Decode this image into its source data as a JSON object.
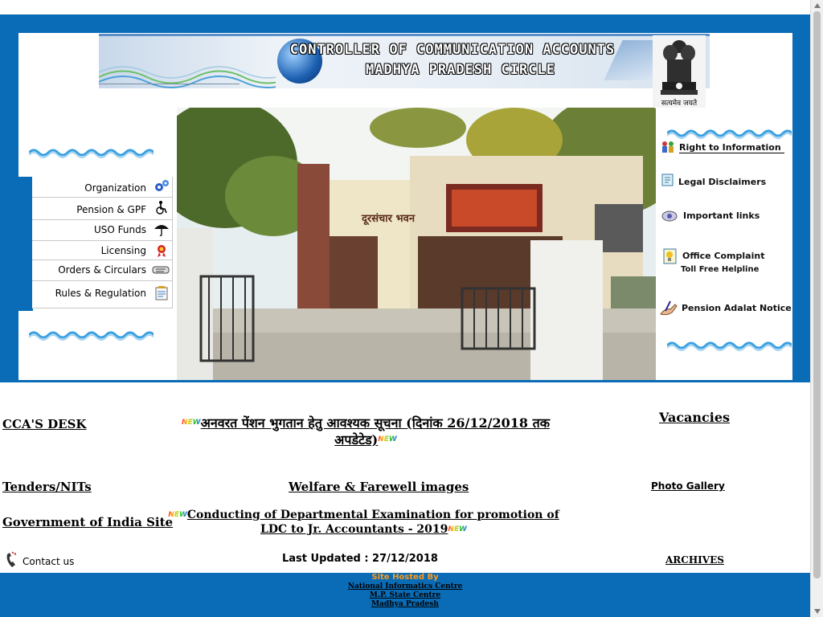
{
  "banner": {
    "line1": "CONTROLLER OF COMMUNICATION ACCOUNTS",
    "line2": "MADHYA PRADESH CIRCLE",
    "emblem_motto": "सत्यमेव जयते"
  },
  "left_menu": {
    "items": [
      {
        "label": "Organization",
        "icon": "gears-icon"
      },
      {
        "label": "Pension & GPF",
        "icon": "wheelchair-icon"
      },
      {
        "label": "USO Funds",
        "icon": "umbrella-icon"
      },
      {
        "label": "Licensing",
        "icon": "ribbon-badge-icon"
      },
      {
        "label": "Orders & Circulars",
        "icon": "scroll-icon"
      },
      {
        "label": "Rules & Regulation",
        "icon": "clipboard-icon"
      }
    ]
  },
  "photo": {
    "sign_text": "दूरसंचार भवन"
  },
  "right_links": [
    {
      "label": "Right to Information",
      "icon": "people-icon"
    },
    {
      "label": "Legal Disclaimers",
      "icon": "document-icon"
    },
    {
      "label": "Important links",
      "icon": "magnifier-icon"
    },
    {
      "label": "Office Complaint",
      "sub": "Toll Free Helpline",
      "icon": "notepad-icon"
    },
    {
      "label": "Pension Adalat Notice",
      "icon": "hand-pen-icon"
    }
  ],
  "content": {
    "ccas_desk": "CCA'S DESK",
    "notice_hindi": "अनवरत पेंशन भुगतान हेतु आवश्यक सूचना (दिनांक 26/12/2018 तक अपडेटेड)",
    "vacancies": "Vacancies",
    "tenders": "Tenders/NITs",
    "welfare": "Welfare & Farewell images",
    "photo_gallery": "Photo Gallery",
    "gov_india": "Government of India Site",
    "exam_notice": "Conducting of Departmental Examination for promotion of LDC to Jr. Accountants - 2019",
    "contact_us": "Contact us",
    "last_updated": "Last Updated : 27/12/2018",
    "archives": "ARCHIVES",
    "new_badge": "NEW"
  },
  "footer": {
    "hosted_by": "Site Hosted By",
    "links": [
      "National Informatics Centre",
      "M.P. State Centre",
      "Madhya Pradesh"
    ]
  },
  "colors": {
    "frame_blue": "#0a6cb6",
    "hosted_orange": "#ff9a1a"
  }
}
